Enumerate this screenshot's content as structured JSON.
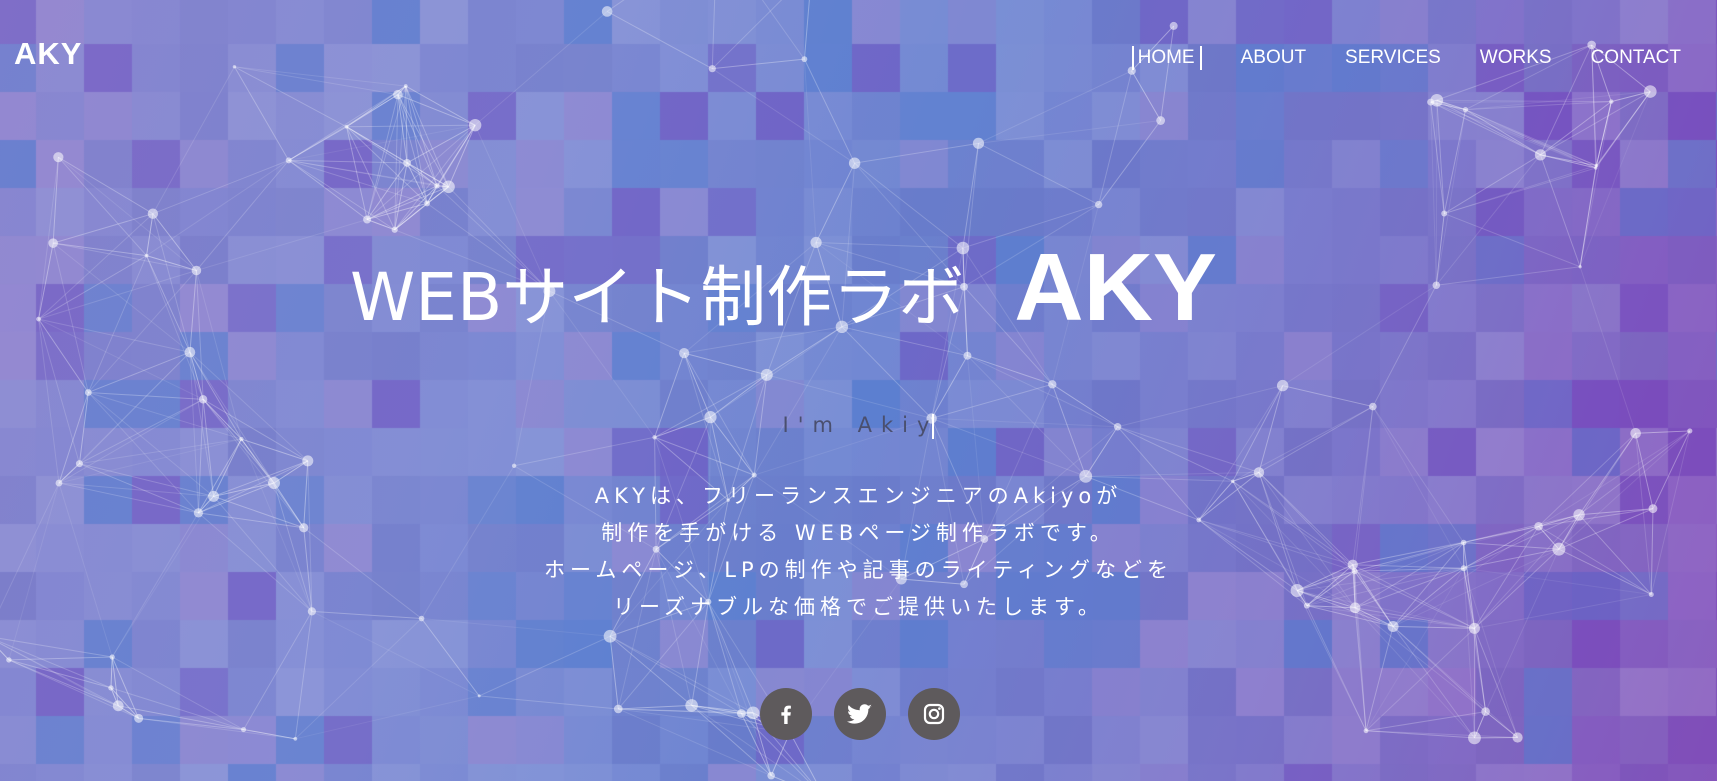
{
  "brand": {
    "logo_text": "AKY"
  },
  "nav": {
    "items": [
      {
        "label": "HOME",
        "active": true
      },
      {
        "label": "ABOUT",
        "active": false
      },
      {
        "label": "SERVICES",
        "active": false
      },
      {
        "label": "WORKS",
        "active": false
      },
      {
        "label": "CONTACT",
        "active": false
      }
    ]
  },
  "hero": {
    "title_jp": "WEBサイト制作ラボ",
    "title_brand": "AKY",
    "tagline": "I'm Akiy",
    "description": [
      "AKYは、フリーランスエンジニアのAkiyoが",
      "制作を手がける WEBページ制作ラボです。",
      "ホームページ、LPの制作や記事のライティングなどを",
      "リーズナブルな価格でご提供いたします。"
    ]
  },
  "social": [
    {
      "name": "facebook",
      "icon": "facebook-icon"
    },
    {
      "name": "twitter",
      "icon": "twitter-icon"
    },
    {
      "name": "instagram",
      "icon": "instagram-icon"
    }
  ],
  "colors": {
    "background_start": "#8a86d0",
    "background_mid": "#6f86d2",
    "background_end": "#8c5fbf",
    "text": "#ffffff",
    "tagline": "#4a4f6e",
    "social_button": "#5e5a5c"
  }
}
